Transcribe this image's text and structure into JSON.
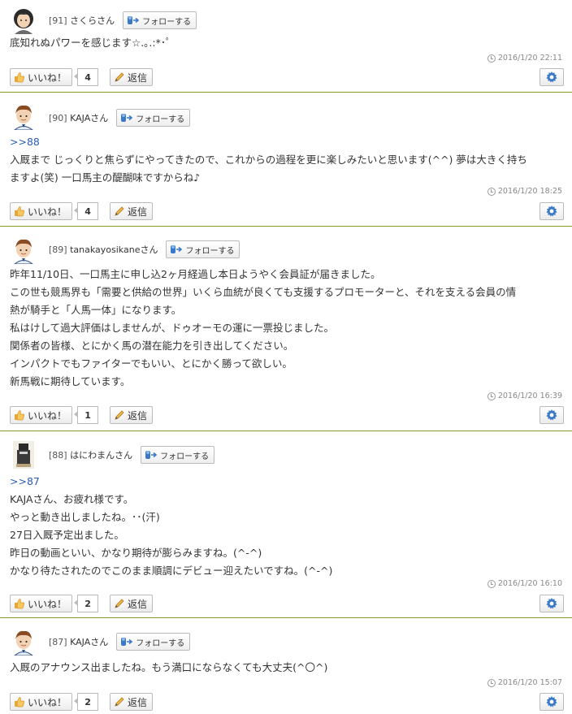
{
  "labels": {
    "follow": "フォローする",
    "like": "いいね！",
    "reply": "返信"
  },
  "colors": {
    "divider": "#8a9a2a",
    "anchor": "#2a5db0",
    "gear": "#3a78c8"
  },
  "comments": [
    {
      "num": "[91]",
      "name": "さくらさん",
      "lines": [
        "底知れぬパワーを感じます☆.｡.:*･ﾟ"
      ],
      "timestamp": "2016/1/20 22:11",
      "likes": "4",
      "avatar": "sakura-avatar"
    },
    {
      "num": "[90]",
      "name": "KAJAさん",
      "anchor": ">>88",
      "lines": [
        "入厩まで じっくりと焦らずにやってきたので、これからの過程を更に楽しみたいと思います(^^) 夢は大きく持ち",
        "ますよ(笑) 一口馬主の醍醐味ですからね♪"
      ],
      "timestamp": "2016/1/20 18:25",
      "likes": "4",
      "avatar": "boy-avatar"
    },
    {
      "num": "[89]",
      "name": "tanakayosikaneさん",
      "lines": [
        "昨年11/10日、一口馬主に申し込2ヶ月経過し本日ようやく会員証が届きました。",
        "この世も競馬界も「需要と供給の世界」いくら血統が良くても支援するプロモーターと、それを支える会員の情",
        "熱が騎手と「人馬一体」になります。",
        "私はけして過大評価はしませんが、ドゥオーモの運に一票投じました。",
        "関係者の皆様、とにかく馬の潜在能力を引き出してください。",
        "インパクトでもファイターでもいい、とにかく勝って欲しい。",
        "新馬戦に期待しています。"
      ],
      "timestamp": "2016/1/20 16:39",
      "likes": "1",
      "avatar": "boy-avatar"
    },
    {
      "num": "[88]",
      "name": "はにわまんさん",
      "anchor": ">>87",
      "lines": [
        "KAJAさん、お疲れ様です。",
        "やっと動き出しましたね。･･(汗)",
        "27日入厩予定出ました。",
        "昨日の動画といい、かなり期待が膨らみますね。(^-^)",
        "かなり待たされたのでこのまま順調にデビュー迎えたいですね。(^-^)"
      ],
      "timestamp": "2016/1/20 16:10",
      "likes": "2",
      "avatar": "haniwa-avatar"
    },
    {
      "num": "[87]",
      "name": "KAJAさん",
      "lines": [
        "入厩のアナウンス出ましたね。もう満口にならなくても大丈夫(^〇^)"
      ],
      "timestamp": "2016/1/20 15:07",
      "likes": "2",
      "avatar": "boy-avatar"
    }
  ]
}
